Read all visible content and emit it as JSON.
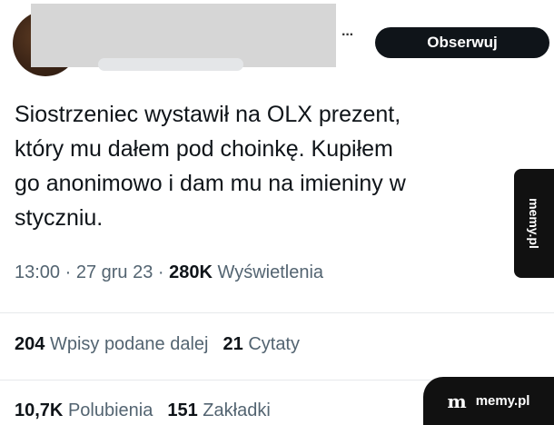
{
  "header": {
    "more_label": "···",
    "follow_label": "Obserwuj"
  },
  "tweet": {
    "text": "Siostrzeniec wystawił na OLX prezent,\nktóry mu dałem pod choinkę. Kupiłem\ngo anonimowo i dam mu na imieniny w\nstyczniu.",
    "time": "13:00",
    "date": "27 gru 23",
    "views_count": "280K",
    "views_label": "Wyświetlenia"
  },
  "stats": {
    "reposts_count": "204",
    "reposts_label": "Wpisy podane dalej",
    "quotes_count": "21",
    "quotes_label": "Cytaty",
    "likes_count": "10,7K",
    "likes_label": "Polubienia",
    "bookmarks_count": "151",
    "bookmarks_label": "Zakładki"
  },
  "watermarks": {
    "side": "memy.pl",
    "corner_logo": "m",
    "corner_text": "memy.pl"
  }
}
